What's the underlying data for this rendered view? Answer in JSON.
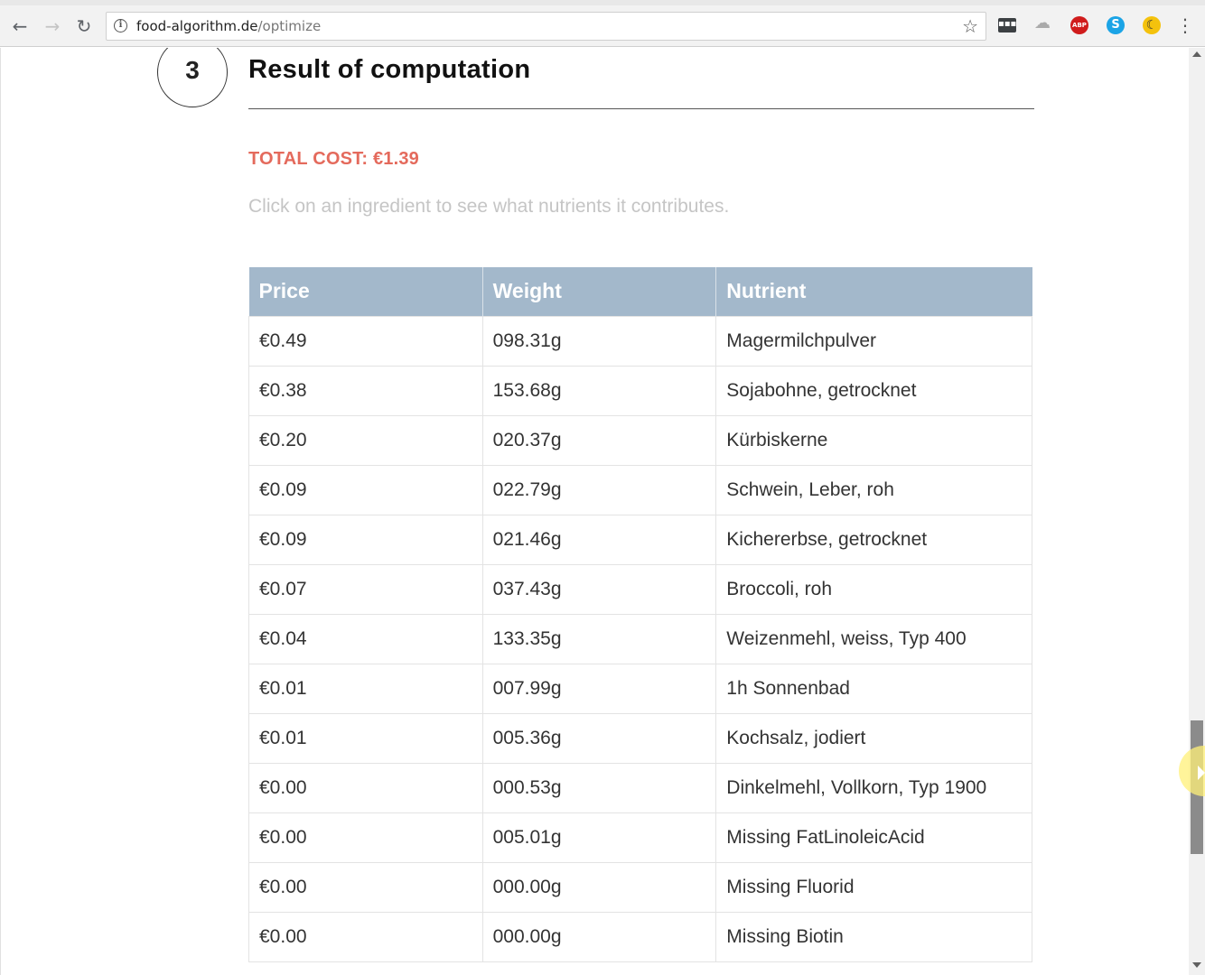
{
  "browser": {
    "url_host": "food-algorithm.de",
    "url_path": "/optimize",
    "extensions": [
      "terminal-extension-icon",
      "cloud-extension-icon",
      "adblock-plus-icon",
      "skype-icon",
      "moon-extension-icon"
    ],
    "abp_label": "ABP",
    "skype_label": "S"
  },
  "section": {
    "step_number": "3",
    "title": "Result of computation",
    "total_cost": "TOTAL COST: €1.39",
    "hint": "Click on an ingredient to see what nutrients it contributes."
  },
  "table": {
    "headers": [
      "Price",
      "Weight",
      "Nutrient"
    ],
    "rows": [
      [
        "€0.49",
        "098.31g",
        "Magermilchpulver"
      ],
      [
        "€0.38",
        "153.68g",
        "Sojabohne, getrocknet"
      ],
      [
        "€0.20",
        "020.37g",
        "Kürbiskerne"
      ],
      [
        "€0.09",
        "022.79g",
        "Schwein, Leber, roh"
      ],
      [
        "€0.09",
        "021.46g",
        "Kichererbse, getrocknet"
      ],
      [
        "€0.07",
        "037.43g",
        "Broccoli, roh"
      ],
      [
        "€0.04",
        "133.35g",
        "Weizenmehl, weiss, Typ 400"
      ],
      [
        "€0.01",
        "007.99g",
        "1h Sonnenbad"
      ],
      [
        "€0.01",
        "005.36g",
        "Kochsalz, jodiert"
      ],
      [
        "€0.00",
        "000.53g",
        "Dinkelmehl, Vollkorn, Typ 1900"
      ],
      [
        "€0.00",
        "005.01g",
        "Missing FatLinoleicAcid"
      ],
      [
        "€0.00",
        "000.00g",
        "Missing Fluorid"
      ],
      [
        "€0.00",
        "000.00g",
        "Missing Biotin"
      ]
    ]
  },
  "colors": {
    "accent_total": "#e46a5c",
    "table_header": "#a3b8cb",
    "hint_text": "#c5c5c5"
  }
}
